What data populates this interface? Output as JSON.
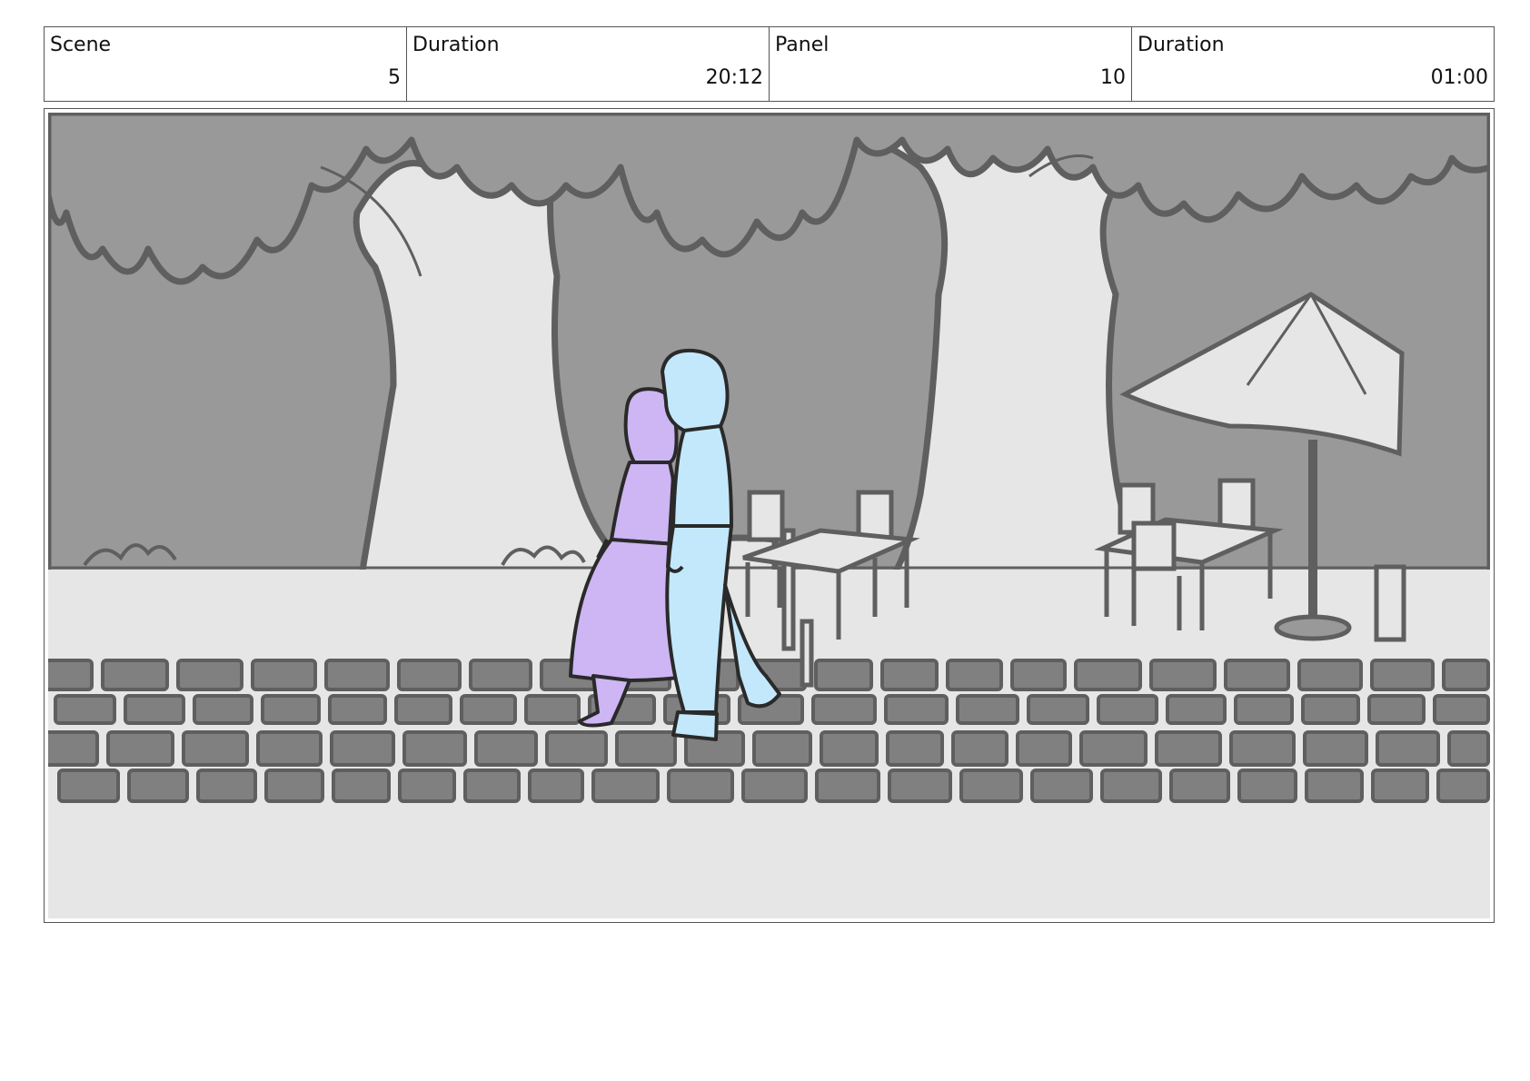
{
  "header": {
    "cells": [
      {
        "label": "Scene",
        "value": "5"
      },
      {
        "label": "Duration",
        "value": "20:12"
      },
      {
        "label": "Panel",
        "value": "10"
      },
      {
        "label": "Duration",
        "value": "01:00"
      }
    ]
  },
  "panel": {
    "colors": {
      "background": "#e6e6e6",
      "foliage": "#999999",
      "outline": "#5f5f5f",
      "paving": "#808080",
      "woman": "#cdb6f3",
      "man": "#c3e8fb",
      "figure_outline": "#2a2a2a"
    }
  }
}
